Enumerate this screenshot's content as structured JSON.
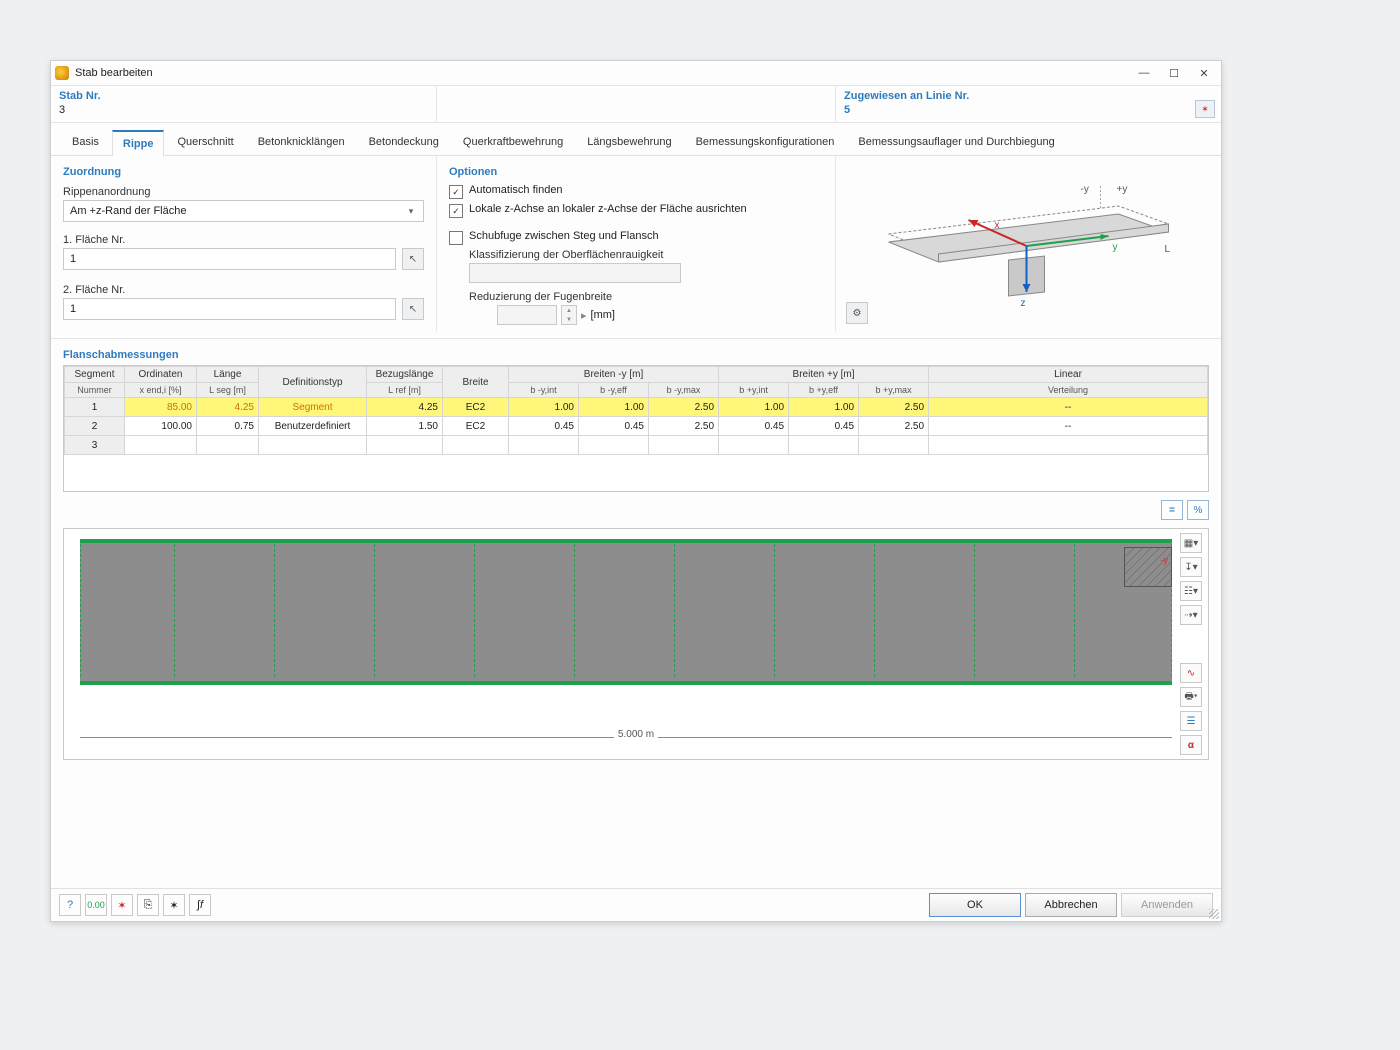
{
  "window": {
    "title": "Stab bearbeiten",
    "minimize": "—",
    "maximize": "☐",
    "close": "✕"
  },
  "header": {
    "stab_nr_label": "Stab Nr.",
    "stab_nr_value": "3",
    "linie_label": "Zugewiesen an Linie Nr.",
    "linie_value": "5"
  },
  "tabs": [
    "Basis",
    "Rippe",
    "Querschnitt",
    "Betonknicklängen",
    "Betondeckung",
    "Querkraftbewehrung",
    "Längsbewehrung",
    "Bemessungskonfigurationen",
    "Bemessungsauflager und Durchbiegung"
  ],
  "active_tab": 1,
  "zuordnung": {
    "title": "Zuordnung",
    "rippen_label": "Rippenanordnung",
    "rippen_value": "Am +z-Rand der Fläche",
    "flaeche1_label": "1. Fläche Nr.",
    "flaeche1_value": "1",
    "flaeche2_label": "2. Fläche Nr.",
    "flaeche2_value": "1"
  },
  "optionen": {
    "title": "Optionen",
    "auto_find": "Automatisch finden",
    "lokale_z": "Lokale z-Achse an lokaler z-Achse der Fläche ausrichten",
    "schubfuge": "Schubfuge zwischen Steg und Flansch",
    "klassif": "Klassifizierung der Oberflächenrauigkeit",
    "reduz": "Reduzierung der Fugenbreite",
    "unit_mm": "[mm]"
  },
  "diagram_labels": {
    "my": "-y",
    "py": "+y",
    "x": "x",
    "y": "y",
    "z": "z",
    "L": "L"
  },
  "flansch": {
    "title": "Flanschabmessungen"
  },
  "table": {
    "col_headers": {
      "segment": "Segment",
      "nummer": "Nummer",
      "ordinaten": "Ordinaten",
      "xend": "x end,i [%]",
      "laenge": "Länge",
      "lseg": "L seg [m]",
      "deftyp": "Definitionstyp",
      "bezug": "Bezugslänge",
      "lref": "L ref [m]",
      "breite": "Breite",
      "breiten_my": "Breiten -y [m]",
      "breiten_py": "Breiten +y [m]",
      "byint": "b -y,int",
      "byeff": "b -y,eff",
      "bymax": "b -y,max",
      "bpyint": "b +y,int",
      "bpyeff": "b +y,eff",
      "bpymax": "b +y,max",
      "linear": "Linear",
      "verteilung": "Verteilung"
    },
    "rows": [
      {
        "seg": "1",
        "xend": "85.00",
        "lseg": "4.25",
        "deftyp": "Segment",
        "lref": "4.25",
        "breite": "EC2",
        "byint": "1.00",
        "byeff": "1.00",
        "bymax": "2.50",
        "bpyint": "1.00",
        "bpyeff": "1.00",
        "bpymax": "2.50",
        "lin": "--",
        "hl": true,
        "orange": true
      },
      {
        "seg": "2",
        "xend": "100.00",
        "lseg": "0.75",
        "deftyp": "Benutzerdefiniert",
        "lref": "1.50",
        "breite": "EC2",
        "byint": "0.45",
        "byeff": "0.45",
        "bymax": "2.50",
        "bpyint": "0.45",
        "bpyeff": "0.45",
        "bpymax": "2.50",
        "lin": "--",
        "hl": false,
        "orange": false
      },
      {
        "seg": "3",
        "xend": "",
        "lseg": "",
        "deftyp": "",
        "lref": "",
        "breite": "",
        "byint": "",
        "byeff": "",
        "bymax": "",
        "bpyint": "",
        "bpyeff": "",
        "bpymax": "",
        "lin": "",
        "hl": false,
        "orange": false
      }
    ]
  },
  "graphic": {
    "dim": "5.000 m"
  },
  "footer": {
    "ok": "OK",
    "cancel": "Abbrechen",
    "apply": "Anwenden"
  }
}
